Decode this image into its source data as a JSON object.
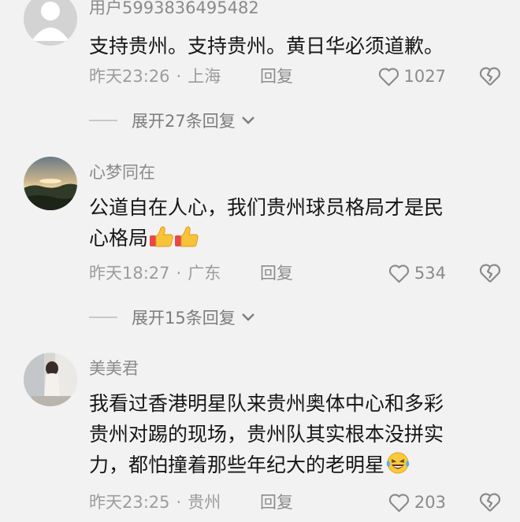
{
  "comments": [
    {
      "username": "用户5993836495482",
      "lines": [
        "支持贵州。支持贵州。黄日华必须道歉。"
      ],
      "time": "昨天23:26",
      "location": "上海",
      "reply_label": "回复",
      "likes": "1027",
      "expand_label": "展开27条回复",
      "avatar_icon": "default-avatar-icon"
    },
    {
      "username": "心梦同在",
      "lines": [
        "公道自在人心，我们贵州球员格局才是民",
        "心格局"
      ],
      "emoji": "thumbs-up-icon",
      "time": "昨天18:27",
      "location": "广东",
      "reply_label": "回复",
      "likes": "534",
      "expand_label": "展开15条回复",
      "avatar_icon": "sunset-landscape-avatar"
    },
    {
      "username": "美美君",
      "lines": [
        "我看过香港明星队来贵州奥体中心和多彩",
        "贵州对踢的现场，贵州队其实根本没拼实",
        "力，都怕撞着那些年纪大的老明星"
      ],
      "emoji": "laughing-tears-icon",
      "time": "昨天23:25",
      "location": "贵州",
      "reply_label": "回复",
      "likes": "203",
      "avatar_icon": "person-photo-avatar"
    }
  ],
  "colors": {
    "background": "#f2f2f2",
    "text": "#161616",
    "muted": "#9c9c9c"
  }
}
